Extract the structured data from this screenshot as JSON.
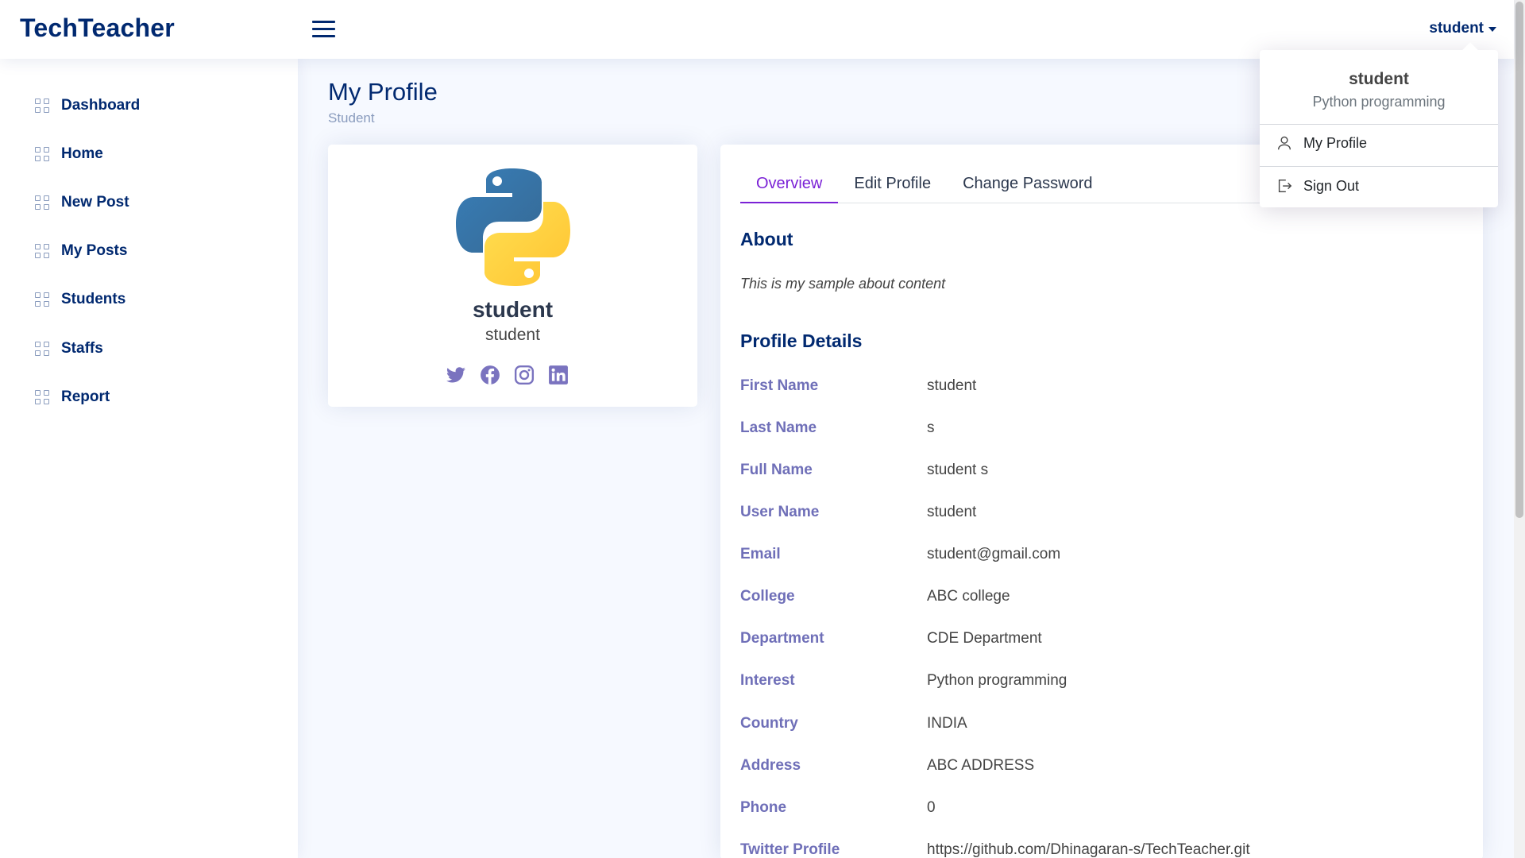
{
  "app": {
    "brand": "TechTeacher"
  },
  "header": {
    "user_label": "student"
  },
  "sidebar": {
    "items": [
      {
        "label": "Dashboard"
      },
      {
        "label": "Home"
      },
      {
        "label": "New Post"
      },
      {
        "label": "My Posts"
      },
      {
        "label": "Students"
      },
      {
        "label": "Staffs"
      },
      {
        "label": "Report"
      }
    ]
  },
  "page": {
    "title": "My Profile",
    "breadcrumb": "Student"
  },
  "profile_card": {
    "name": "student",
    "role": "student",
    "social_icons": [
      "twitter-icon",
      "facebook-icon",
      "instagram-icon",
      "linkedin-icon"
    ]
  },
  "tabs": [
    {
      "label": "Overview",
      "active": true
    },
    {
      "label": "Edit Profile",
      "active": false
    },
    {
      "label": "Change Password",
      "active": false
    }
  ],
  "about": {
    "title": "About",
    "text": "This is my sample about content"
  },
  "details": {
    "title": "Profile Details",
    "rows": [
      {
        "label": "First Name",
        "value": "student"
      },
      {
        "label": "Last Name",
        "value": "s"
      },
      {
        "label": "Full Name",
        "value": "student s"
      },
      {
        "label": "User Name",
        "value": "student"
      },
      {
        "label": "Email",
        "value": "student@gmail.com"
      },
      {
        "label": "College",
        "value": "ABC college"
      },
      {
        "label": "Department",
        "value": "CDE Department"
      },
      {
        "label": "Interest",
        "value": "Python programming"
      },
      {
        "label": "Country",
        "value": "INDIA"
      },
      {
        "label": "Address",
        "value": "ABC ADDRESS"
      },
      {
        "label": "Phone",
        "value": "0"
      },
      {
        "label": "Twitter Profile",
        "value": "https://github.com/Dhinagaran-s/TechTeacher.git"
      }
    ]
  },
  "dropdown": {
    "name": "student",
    "subtitle": "Python programming",
    "items": [
      {
        "label": "My Profile",
        "icon": "person-icon"
      },
      {
        "label": "Sign Out",
        "icon": "sign-out-icon"
      }
    ]
  },
  "colors": {
    "brand": "#012970",
    "accent": "#7b22d6",
    "label": "#6f6fb8",
    "background": "#f6f9ff"
  }
}
